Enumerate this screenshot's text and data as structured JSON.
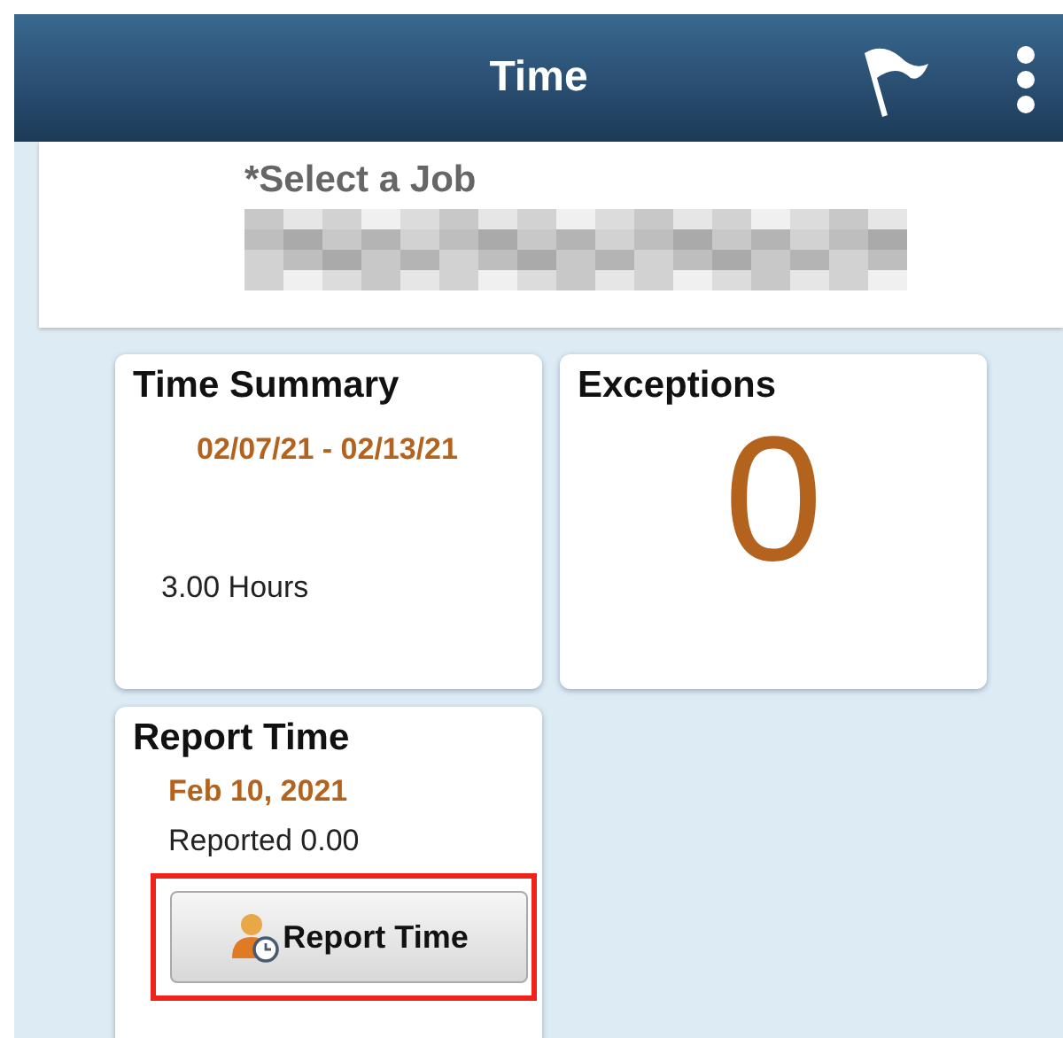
{
  "header": {
    "title": "Time"
  },
  "job": {
    "label": "*Select a Job"
  },
  "tiles": [
    {
      "kind": "summary",
      "title": "Time Summary",
      "period": "02/07/21 - 02/13/21",
      "hours": "3.00 Hours"
    },
    {
      "kind": "count",
      "title": "Exceptions",
      "count": "0"
    },
    {
      "kind": "report",
      "title": "Report Time",
      "date": "Feb 10, 2021",
      "reported": "Reported 0.00",
      "button": "Report Time",
      "highlighted": true
    }
  ]
}
